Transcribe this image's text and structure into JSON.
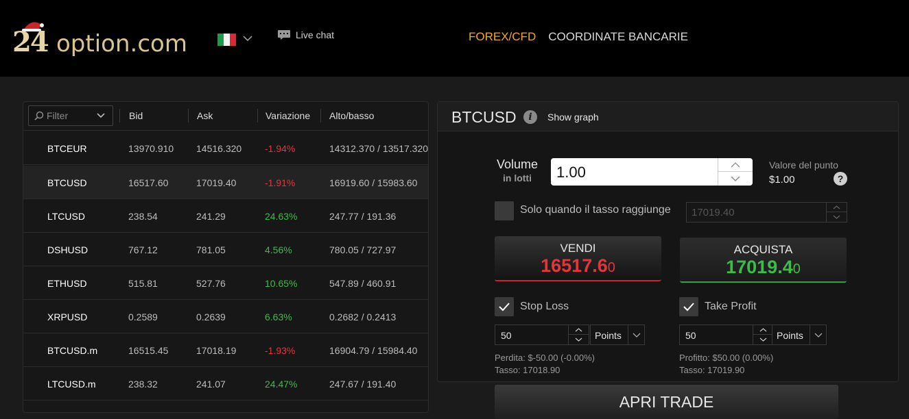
{
  "header": {
    "logo_number": "24",
    "logo_domain": "option.com",
    "language_flag": "italy-flag",
    "live_chat_label": "Live chat",
    "nav": [
      {
        "label": "FOREX/CFD",
        "active": true
      },
      {
        "label": "COORDINATE BANCARIE",
        "active": false
      }
    ]
  },
  "table": {
    "filter_placeholder": "Filter",
    "columns": [
      "Bid",
      "Ask",
      "Variazione",
      "Alto/basso"
    ],
    "rows": [
      {
        "symbol": "BTCEUR",
        "bid": "13970.910",
        "ask": "14516.320",
        "change": "-1.94%",
        "dir": "neg",
        "high_low": "14312.370 / 13517.320"
      },
      {
        "symbol": "BTCUSD",
        "bid": "16517.60",
        "ask": "17019.40",
        "change": "-1.91%",
        "dir": "neg",
        "high_low": "16919.60 / 15983.60",
        "selected": true
      },
      {
        "symbol": "LTCUSD",
        "bid": "238.54",
        "ask": "241.29",
        "change": "24.63%",
        "dir": "pos",
        "high_low": "247.77 / 191.36"
      },
      {
        "symbol": "DSHUSD",
        "bid": "767.12",
        "ask": "781.05",
        "change": "4.56%",
        "dir": "pos",
        "high_low": "780.05 / 727.97"
      },
      {
        "symbol": "ETHUSD",
        "bid": "515.81",
        "ask": "527.76",
        "change": "10.65%",
        "dir": "pos",
        "high_low": "547.89 / 460.91"
      },
      {
        "symbol": "XRPUSD",
        "bid": "0.2589",
        "ask": "0.2639",
        "change": "6.63%",
        "dir": "pos",
        "high_low": "0.2682 / 0.2413"
      },
      {
        "symbol": "BTCUSD.m",
        "bid": "16515.45",
        "ask": "17018.19",
        "change": "-1.93%",
        "dir": "neg",
        "high_low": "16904.79 / 15984.40"
      },
      {
        "symbol": "LTCUSD.m",
        "bid": "238.32",
        "ask": "241.07",
        "change": "24.47%",
        "dir": "pos",
        "high_low": "247.67 / 191.40"
      }
    ]
  },
  "trade": {
    "instrument": "BTCUSD",
    "show_graph_label": "Show graph",
    "volume_label": "Volume",
    "volume_sub": "in lotti",
    "volume_value": "1.00",
    "point_value_label": "Valore del punto",
    "point_value": "$1.00",
    "only_when_label": "Solo quando il tasso raggiunge",
    "only_when_value": "17019.40",
    "sell": {
      "label": "VENDI",
      "price_main": "16517.6",
      "price_pip": "0"
    },
    "buy": {
      "label": "ACQUISTA",
      "price_main": "17019.4",
      "price_pip": "0"
    },
    "stop_loss": {
      "label": "Stop Loss",
      "value": "50",
      "unit": "Points",
      "info1": "Perdita: $-50.00 (-0.00%)",
      "info2": "Tasso: 17018.90",
      "checked": true
    },
    "take_profit": {
      "label": "Take Profit",
      "value": "50",
      "unit": "Points",
      "info1": "Profitto: $50.00 (0.00%)",
      "info2": "Tasso: 17019.90",
      "checked": true
    },
    "open_trade_label": "APRI TRADE"
  },
  "colors": {
    "accent": "#f4a91c",
    "negative": "#e3363b",
    "positive": "#3cbc4b"
  }
}
